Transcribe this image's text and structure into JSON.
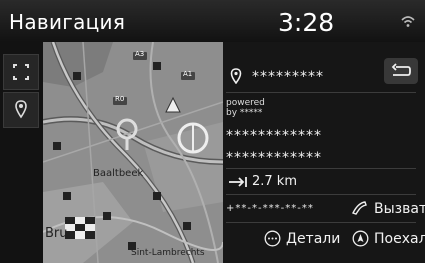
{
  "header": {
    "title": "Навигация",
    "clock": "3:28"
  },
  "destination": {
    "name": "*********",
    "powered_line1": "powered",
    "powered_line2": "by *****",
    "address_line1": "************",
    "address_line2": "************",
    "distance": "2.7 km",
    "phone": "+**-*-***-**-**"
  },
  "actions": {
    "call": "Вызвать",
    "details": "Детали",
    "go": "Поехали"
  },
  "map": {
    "labels": [
      "Baaltbeek",
      "Bru",
      "Sint-Lambrechts",
      "A1",
      "A3",
      "R0"
    ]
  },
  "icons": {
    "wifi": "wifi-signal-icon",
    "expand": "expand-map-icon",
    "location": "location-pin-icon",
    "back": "back-arrow-icon",
    "distance": "distance-arrow-icon",
    "phone": "phone-icon",
    "details": "more-dots-icon",
    "go": "navigate-arrow-icon"
  }
}
